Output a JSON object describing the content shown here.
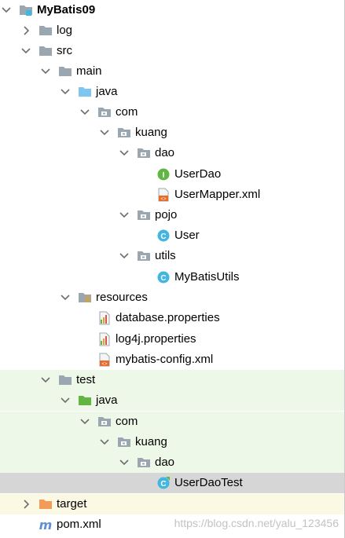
{
  "tree": [
    {
      "label": "MyBatis09",
      "name": "project-root",
      "arrow": "down",
      "icon": "module-icon",
      "bold": true
    },
    {
      "label": "log",
      "name": "folder-log",
      "arrow": "right",
      "icon": "folder-icon"
    },
    {
      "label": "src",
      "name": "folder-src",
      "arrow": "down",
      "icon": "folder-icon"
    },
    {
      "label": "main",
      "name": "folder-main",
      "arrow": "down",
      "icon": "folder-icon"
    },
    {
      "label": "java",
      "name": "folder-main-java",
      "arrow": "down",
      "icon": "source-folder-icon"
    },
    {
      "label": "com",
      "name": "package-com",
      "arrow": "down",
      "icon": "package-icon"
    },
    {
      "label": "kuang",
      "name": "package-kuang",
      "arrow": "down",
      "icon": "package-icon"
    },
    {
      "label": "dao",
      "name": "package-dao",
      "arrow": "down",
      "icon": "package-icon"
    },
    {
      "label": "UserDao",
      "name": "file-userdao",
      "arrow": "",
      "icon": "interface-icon"
    },
    {
      "label": "UserMapper.xml",
      "name": "file-usermapper-xml",
      "arrow": "",
      "icon": "xml-file-icon"
    },
    {
      "label": "pojo",
      "name": "package-pojo",
      "arrow": "down",
      "icon": "package-icon"
    },
    {
      "label": "User",
      "name": "file-user",
      "arrow": "",
      "icon": "class-icon"
    },
    {
      "label": "utils",
      "name": "package-utils",
      "arrow": "down",
      "icon": "package-icon"
    },
    {
      "label": "MyBatisUtils",
      "name": "file-mybatisutils",
      "arrow": "",
      "icon": "class-icon"
    },
    {
      "label": "resources",
      "name": "folder-resources",
      "arrow": "down",
      "icon": "resources-folder-icon"
    },
    {
      "label": "database.properties",
      "name": "file-database-properties",
      "arrow": "",
      "icon": "properties-file-icon"
    },
    {
      "label": "log4j.properties",
      "name": "file-log4j-properties",
      "arrow": "",
      "icon": "properties-file-icon"
    },
    {
      "label": "mybatis-config.xml",
      "name": "file-mybatis-config-xml",
      "arrow": "",
      "icon": "xml-file-icon"
    },
    {
      "label": "test",
      "name": "folder-test",
      "arrow": "down",
      "icon": "folder-icon",
      "bg": "test"
    },
    {
      "label": "java",
      "name": "folder-test-java",
      "arrow": "down",
      "icon": "test-source-folder-icon",
      "bg": "test"
    },
    {
      "label": "com",
      "name": "test-package-com",
      "arrow": "down",
      "icon": "package-icon",
      "bg": "test"
    },
    {
      "label": "kuang",
      "name": "test-package-kuang",
      "arrow": "down",
      "icon": "package-icon",
      "bg": "test"
    },
    {
      "label": "dao",
      "name": "test-package-dao",
      "arrow": "down",
      "icon": "package-icon",
      "bg": "test"
    },
    {
      "label": "UserDaoTest",
      "name": "file-userdaotest",
      "arrow": "",
      "icon": "test-class-icon",
      "bg": "selected"
    },
    {
      "label": "target",
      "name": "folder-target",
      "arrow": "right",
      "icon": "excluded-folder-icon",
      "bg": "excluded"
    },
    {
      "label": "pom.xml",
      "name": "file-pom-xml",
      "arrow": "",
      "icon": "maven-icon"
    }
  ],
  "watermark": "https://blog.csdn.net/yalu_123456",
  "colors": {
    "folder": "#9aa7b0",
    "source_folder": "#7fc5ef",
    "test_folder": "#62b543",
    "excluded_folder": "#f39c5a",
    "class": "#40b6e0",
    "interface": "#62b543",
    "xml": "#e8692a",
    "maven": "#c5527c",
    "test_bg": "#eef8e8",
    "selected_bg": "#d6d6d6",
    "excluded_bg": "#fbf8e3"
  }
}
